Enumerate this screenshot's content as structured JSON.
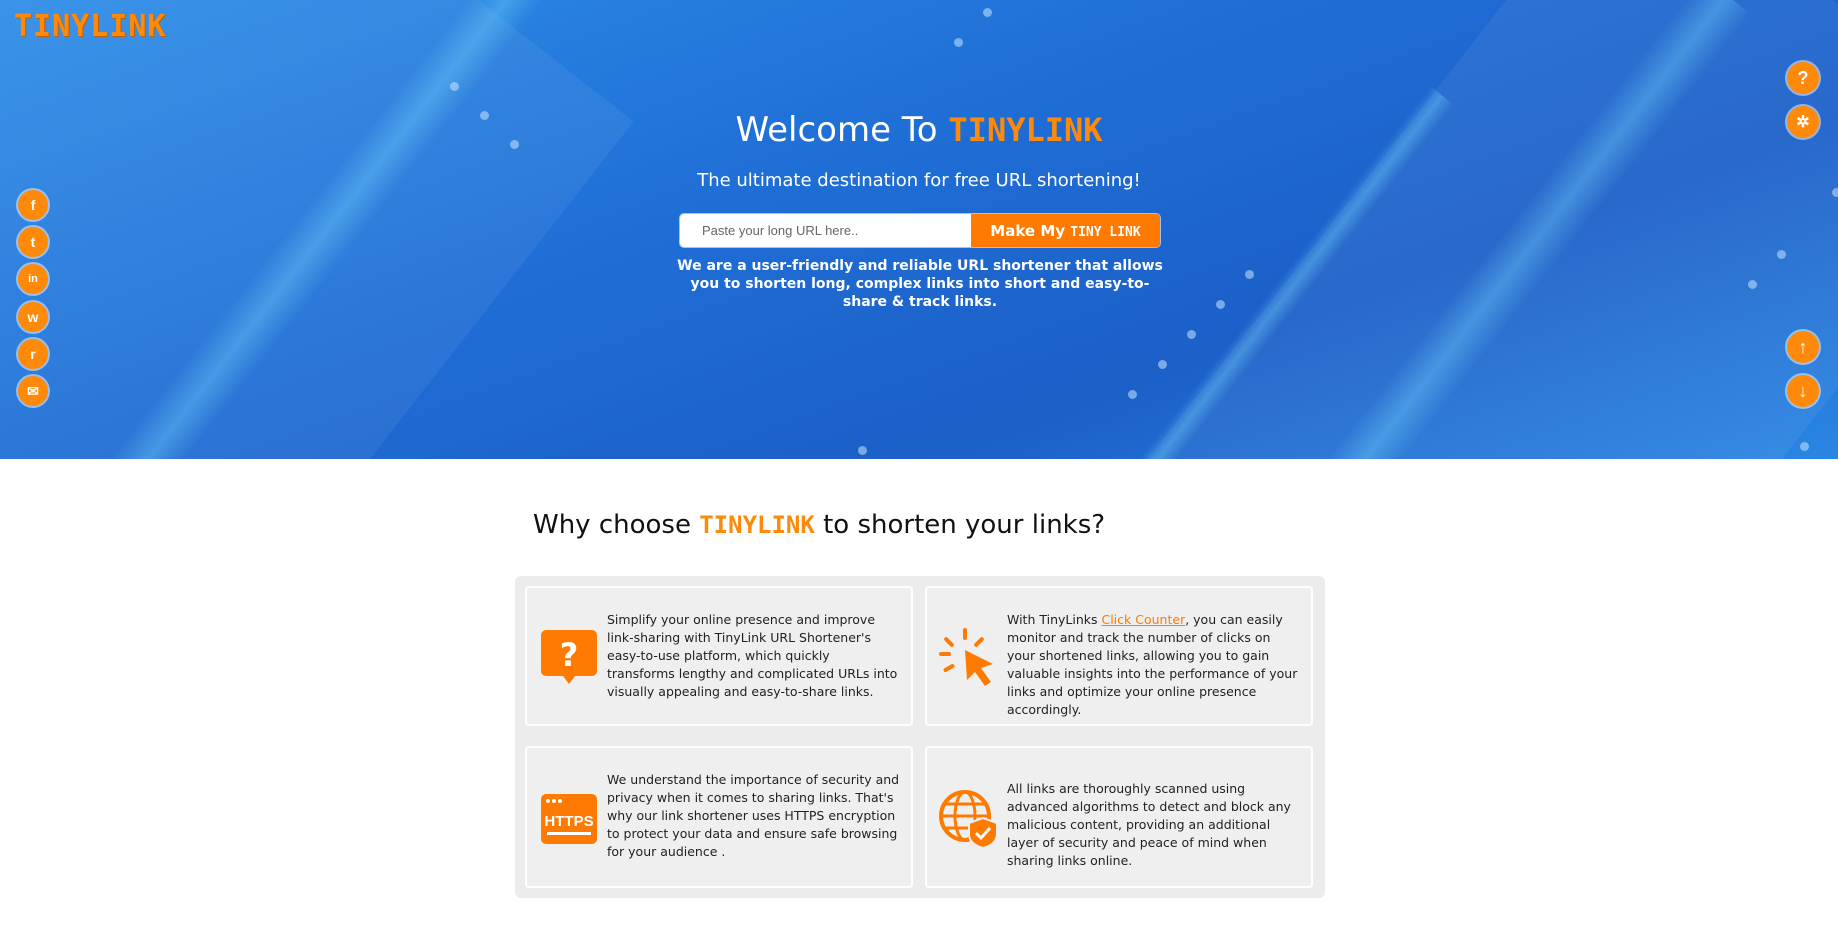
{
  "header": {
    "logo": "TINYLINK"
  },
  "hero": {
    "welcome_prefix": "Welcome To ",
    "welcome_brand": "TINYLINK",
    "tagline": "The ultimate destination for free URL shortening!",
    "url_input": {
      "placeholder": "Paste your long URL here.."
    },
    "submit": {
      "prefix": "Make My ",
      "brand": "TINY LINK"
    },
    "description": "We are a user-friendly and reliable URL shortener that allows you to shorten long, complex links into short and easy-to-share & track links."
  },
  "social": [
    {
      "name": "facebook-icon",
      "glyph": "f"
    },
    {
      "name": "twitter-icon",
      "glyph": "t"
    },
    {
      "name": "linkedin-icon",
      "glyph": "in"
    },
    {
      "name": "whatsapp-icon",
      "glyph": "w"
    },
    {
      "name": "reddit-icon",
      "glyph": "r"
    },
    {
      "name": "email-icon",
      "glyph": "✉"
    }
  ],
  "right_controls": {
    "help": "?",
    "click_counter": "✲",
    "scroll_up": "↑",
    "scroll_down": "↓"
  },
  "why": {
    "prefix": "Why choose ",
    "brand": "TINYLINK",
    "suffix": " to shorten your links?"
  },
  "features": [
    {
      "icon": "question-bubble-icon",
      "text": "Simplify your online presence and improve link-sharing with TinyLink URL Shortener's easy-to-use platform, which quickly transforms lengthy and complicated URLs into visually appealing and easy-to-share links."
    },
    {
      "icon": "cursor-click-icon",
      "text_before": "With TinyLinks ",
      "link": "Click Counter",
      "text_after": ", you can easily monitor and track the number of clicks on your shortened links, allowing you to gain valuable insights into the performance of your links and optimize your online presence accordingly."
    },
    {
      "icon": "https-icon",
      "icon_label": "HTTPS",
      "text": "We understand the importance of security and privacy when it comes to sharing links. That's why our link shortener uses HTTPS encryption to protect your data and ensure safe browsing for your audience ."
    },
    {
      "icon": "globe-shield-icon",
      "text": "All links are thoroughly scanned using advanced algorithms to detect and block any malicious content, providing an additional layer of security and peace of mind when sharing links online."
    }
  ],
  "colors": {
    "accent": "#ff8a0a",
    "hero_blue": "#1f6fd6"
  }
}
